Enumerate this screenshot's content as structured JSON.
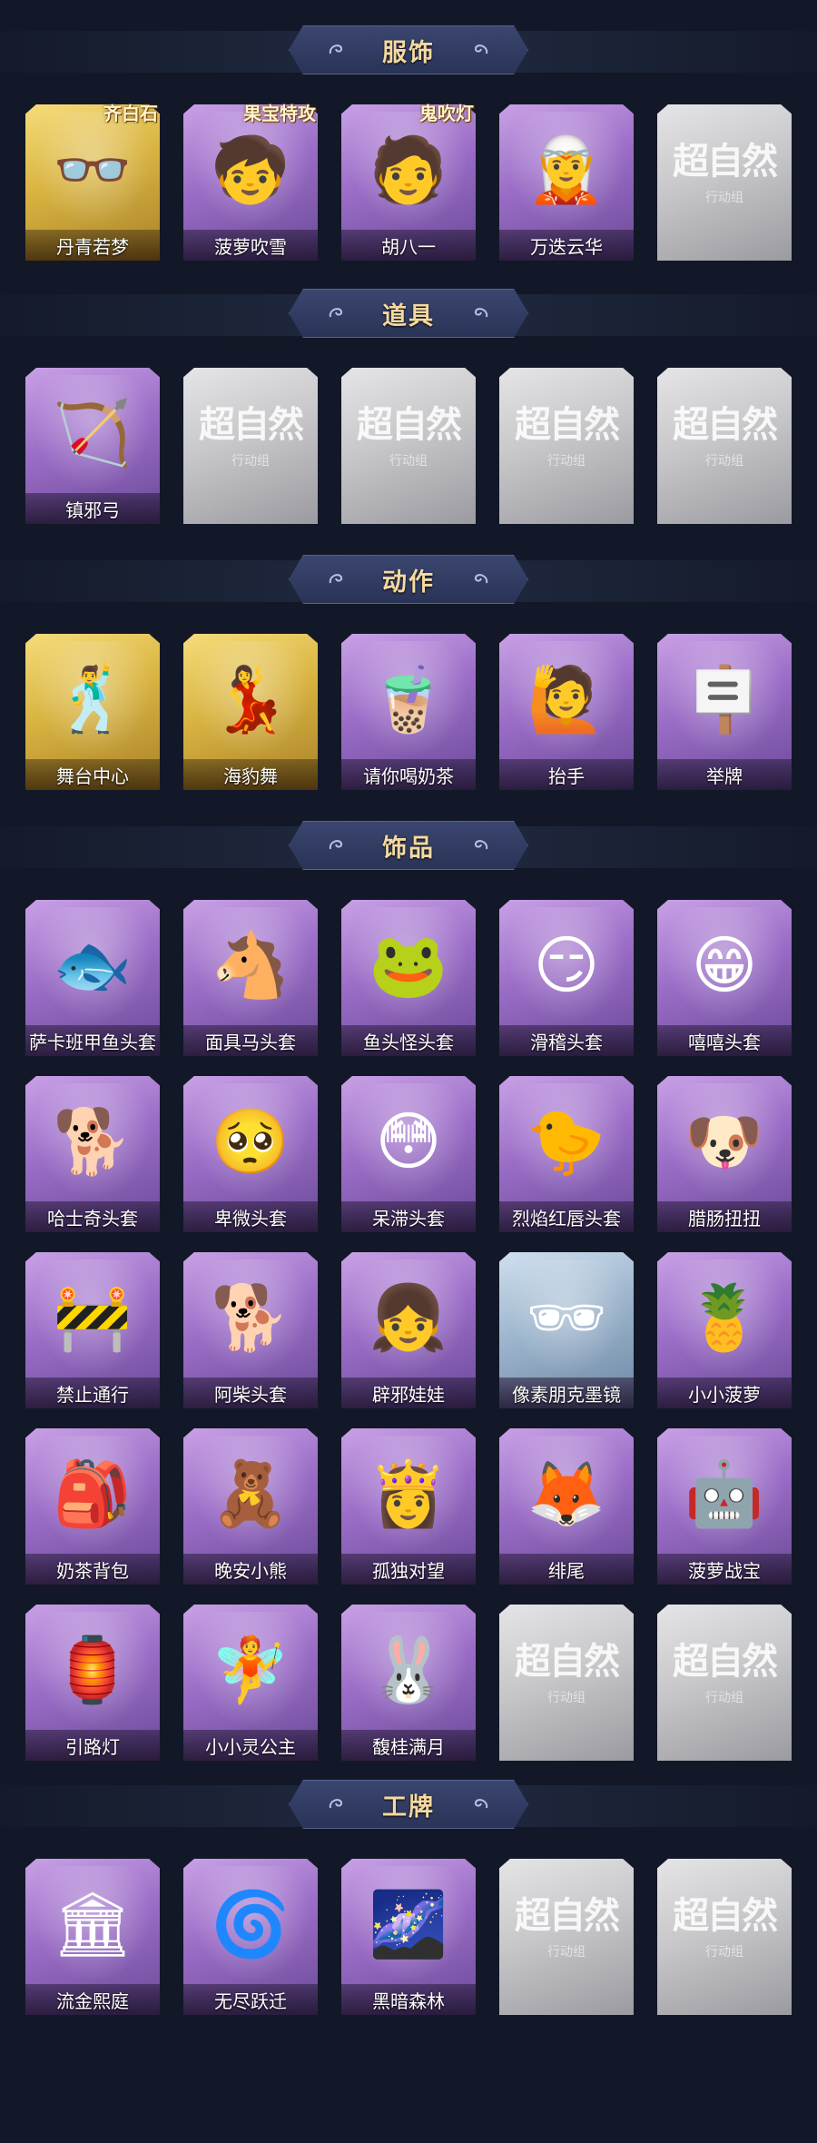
{
  "watermark": {
    "main": "超自然",
    "sub": "行动组"
  },
  "sections": [
    {
      "title": "服饰",
      "items": [
        {
          "label": "丹青若梦",
          "style": "gold",
          "icon": "👓",
          "badge": "齐白石"
        },
        {
          "label": "菠萝吹雪",
          "style": "purple",
          "icon": "🧒",
          "badge": "果宝特攻"
        },
        {
          "label": "胡八一",
          "style": "purple",
          "icon": "🧑",
          "badge": "鬼吹灯"
        },
        {
          "label": "万迭云华",
          "style": "purple",
          "icon": "🧝",
          "badge": ""
        },
        {
          "label": "",
          "style": "gray",
          "icon": "",
          "badge": ""
        }
      ]
    },
    {
      "title": "道具",
      "items": [
        {
          "label": "镇邪弓",
          "style": "purple",
          "icon": "🏹",
          "badge": ""
        },
        {
          "label": "",
          "style": "gray",
          "icon": "",
          "badge": ""
        },
        {
          "label": "",
          "style": "gray",
          "icon": "",
          "badge": ""
        },
        {
          "label": "",
          "style": "gray",
          "icon": "",
          "badge": ""
        },
        {
          "label": "",
          "style": "gray",
          "icon": "",
          "badge": ""
        }
      ]
    },
    {
      "title": "动作",
      "items": [
        {
          "label": "舞台中心",
          "style": "gold",
          "icon": "🕺",
          "badge": ""
        },
        {
          "label": "海豹舞",
          "style": "gold",
          "icon": "💃",
          "badge": ""
        },
        {
          "label": "请你喝奶茶",
          "style": "purple",
          "icon": "🧋",
          "badge": ""
        },
        {
          "label": "抬手",
          "style": "purple",
          "icon": "🙋",
          "badge": ""
        },
        {
          "label": "举牌",
          "style": "purple",
          "icon": "🪧",
          "badge": ""
        }
      ]
    },
    {
      "title": "饰品",
      "items": [
        {
          "label": "萨卡班甲鱼头套",
          "style": "purple",
          "icon": "🐟",
          "badge": ""
        },
        {
          "label": "面具马头套",
          "style": "purple",
          "icon": "🐴",
          "badge": ""
        },
        {
          "label": "鱼头怪头套",
          "style": "purple",
          "icon": "🐸",
          "badge": ""
        },
        {
          "label": "滑稽头套",
          "style": "purple",
          "icon": "😏",
          "badge": ""
        },
        {
          "label": "嘻嘻头套",
          "style": "purple",
          "icon": "😁",
          "badge": ""
        },
        {
          "label": "哈士奇头套",
          "style": "purple",
          "icon": "🐕",
          "badge": ""
        },
        {
          "label": "卑微头套",
          "style": "purple",
          "icon": "🥺",
          "badge": ""
        },
        {
          "label": "呆滞头套",
          "style": "purple",
          "icon": "😳",
          "badge": ""
        },
        {
          "label": "烈焰红唇头套",
          "style": "purple",
          "icon": "🐤",
          "badge": ""
        },
        {
          "label": "腊肠扭扭",
          "style": "purple",
          "icon": "🐶",
          "badge": ""
        },
        {
          "label": "禁止通行",
          "style": "purple",
          "icon": "🚧",
          "badge": ""
        },
        {
          "label": "阿柴头套",
          "style": "purple",
          "icon": "🐕",
          "badge": ""
        },
        {
          "label": "辟邪娃娃",
          "style": "purple",
          "icon": "👧",
          "badge": ""
        },
        {
          "label": "像素朋克墨镜",
          "style": "blue",
          "icon": "🕶",
          "badge": ""
        },
        {
          "label": "小小菠萝",
          "style": "purple",
          "icon": "🍍",
          "badge": ""
        },
        {
          "label": "奶茶背包",
          "style": "purple",
          "icon": "🎒",
          "badge": ""
        },
        {
          "label": "晚安小熊",
          "style": "purple",
          "icon": "🧸",
          "badge": ""
        },
        {
          "label": "孤独对望",
          "style": "purple",
          "icon": "👸",
          "badge": ""
        },
        {
          "label": "绯尾",
          "style": "purple",
          "icon": "🦊",
          "badge": ""
        },
        {
          "label": "菠萝战宝",
          "style": "purple",
          "icon": "🤖",
          "badge": ""
        },
        {
          "label": "引路灯",
          "style": "purple",
          "icon": "🏮",
          "badge": ""
        },
        {
          "label": "小小灵公主",
          "style": "purple",
          "icon": "🧚",
          "badge": ""
        },
        {
          "label": "馥桂满月",
          "style": "purple",
          "icon": "🐰",
          "badge": ""
        },
        {
          "label": "",
          "style": "gray",
          "icon": "",
          "badge": ""
        },
        {
          "label": "",
          "style": "gray",
          "icon": "",
          "badge": ""
        }
      ]
    },
    {
      "title": "工牌",
      "items": [
        {
          "label": "流金熙庭",
          "style": "purple",
          "icon": "🏛",
          "badge": ""
        },
        {
          "label": "无尽跃迁",
          "style": "purple",
          "icon": "🌀",
          "badge": ""
        },
        {
          "label": "黑暗森林",
          "style": "purple",
          "icon": "🌌",
          "badge": ""
        },
        {
          "label": "",
          "style": "gray",
          "icon": "",
          "badge": ""
        },
        {
          "label": "",
          "style": "gray",
          "icon": "",
          "badge": ""
        }
      ]
    }
  ]
}
